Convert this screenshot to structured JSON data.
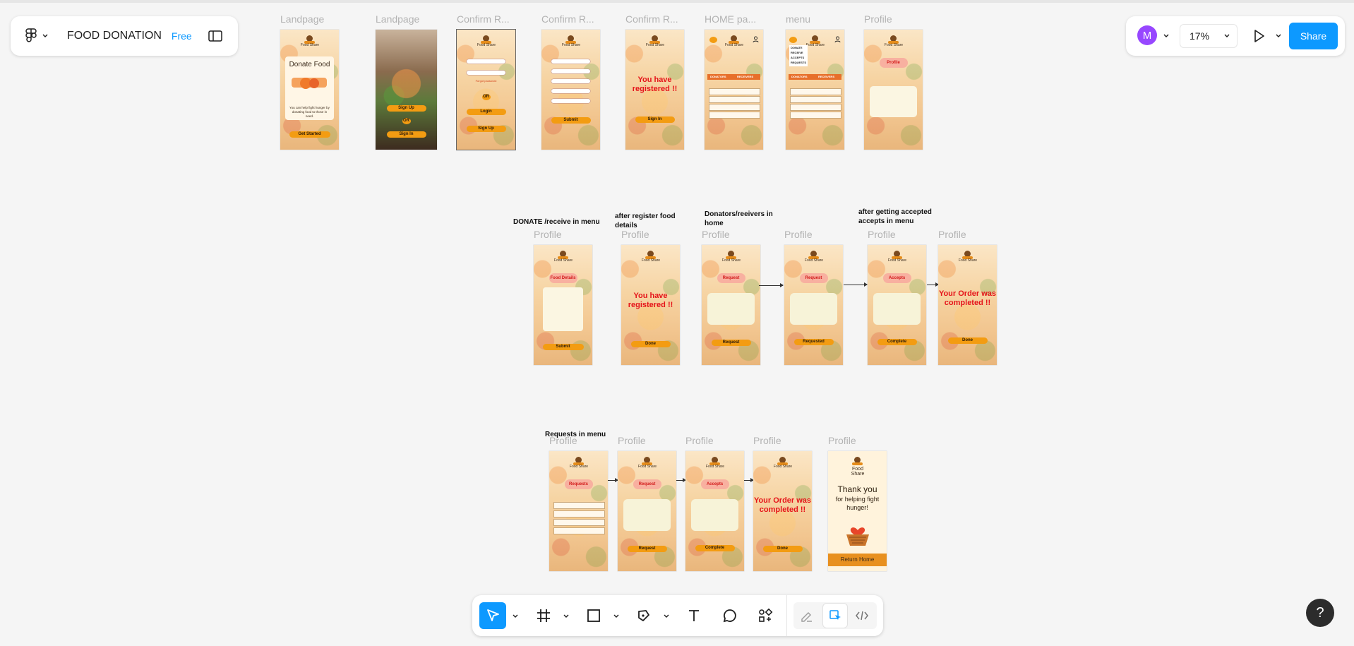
{
  "file_panel": {
    "file_name": "FOOD DONATION",
    "plan_badge": "Free"
  },
  "right_panel": {
    "avatar_initial": "M",
    "zoom_level": "17%",
    "share_label": "Share"
  },
  "frames_row1": [
    {
      "label": "Landpage",
      "title": "Donate Food",
      "body": "You can help fight hunger by donating food to those in need.",
      "button": "Get Started"
    },
    {
      "label": "Landpage",
      "buttons": [
        "Sign Up",
        "OR",
        "Sign In"
      ]
    },
    {
      "label": "Confirm R...",
      "buttons": [
        "Login",
        "OR",
        "Sign Up"
      ],
      "link": "Forgot password"
    },
    {
      "label": "Confirm R...",
      "button": "Submit"
    },
    {
      "label": "Confirm R...",
      "message": "You have registered !!",
      "button": "Sign In"
    },
    {
      "label": "HOME pa...",
      "tabs": [
        "DONATORS",
        "RECEIVERS"
      ]
    },
    {
      "label": "menu",
      "menu_items": [
        "DONATE",
        "RECEIVE",
        "ACCEPTS",
        "REQUESTS"
      ],
      "tabs": [
        "DONATORS",
        "RECEIVERS"
      ]
    },
    {
      "label": "Profile",
      "pill": "Profile"
    }
  ],
  "annotations_row2": [
    "DONATE /receive in menu",
    "after register food details",
    "Donators/reeivers in home",
    "after getting accepted accepts in menu"
  ],
  "frames_row2": [
    {
      "label": "Profile",
      "pill": "Food Details",
      "button": "Submit"
    },
    {
      "label": "Profile",
      "message": "You have registered !!",
      "button": "Done"
    },
    {
      "label": "Profile",
      "pill": "Request",
      "button": "Request"
    },
    {
      "label": "Profile",
      "pill": "Request",
      "button": "Requested"
    },
    {
      "label": "Profile",
      "pill": "Accepts",
      "button": "Complete"
    },
    {
      "label": "Profile",
      "message": "Your Order was completed !!",
      "button": "Done"
    }
  ],
  "annotation_row3": "Requests in menu",
  "frames_row3": [
    {
      "label": "Profile",
      "pill": "Requests"
    },
    {
      "label": "Profile",
      "pill": "Request",
      "button": "Request"
    },
    {
      "label": "Profile",
      "pill": "Accepts",
      "button": "Complete"
    },
    {
      "label": "Profile",
      "message": "Your Order was completed !!",
      "button": "Done"
    },
    {
      "label": "Profile",
      "thanks_title": "Thank you",
      "thanks_sub": "for helping fight hunger!",
      "button": "Return Home"
    }
  ],
  "logo_text": "Food Share",
  "toolbar": {
    "tools": [
      "move-tool",
      "frame-tool",
      "shape-tool",
      "pen-tool",
      "text-tool",
      "comment-tool",
      "actions-tool"
    ],
    "modes": [
      "draw-mode",
      "design-mode",
      "dev-mode"
    ]
  },
  "help": {
    "label": "?"
  }
}
